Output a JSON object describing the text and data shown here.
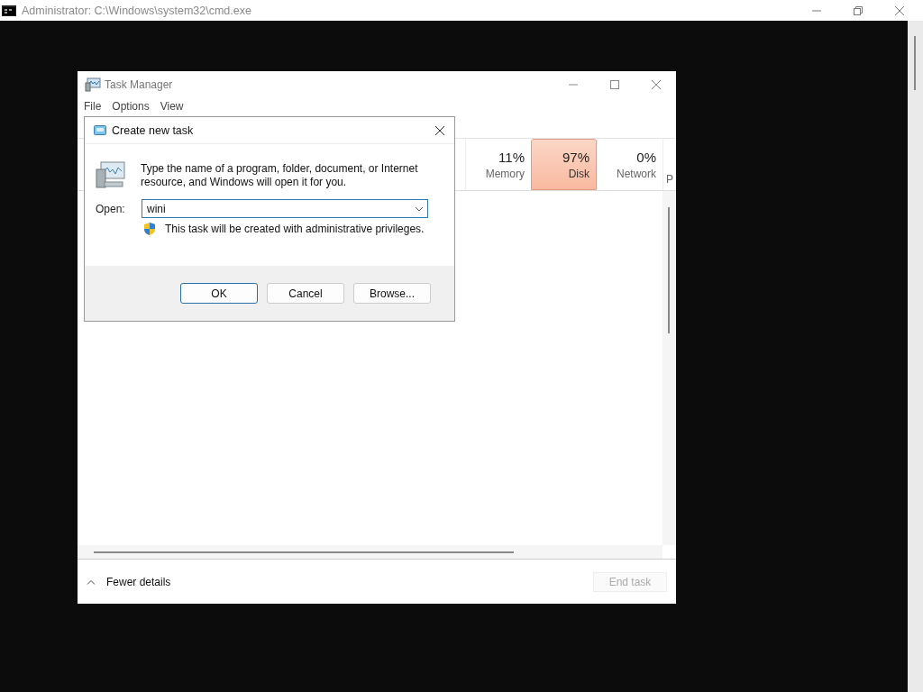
{
  "console": {
    "title": "Administrator: C:\\Windows\\system32\\cmd.exe"
  },
  "task_manager": {
    "title": "Task Manager",
    "menu": [
      "File",
      "Options",
      "View"
    ],
    "columns": [
      {
        "percent": "11%",
        "label": "Memory",
        "selected": false
      },
      {
        "percent": "97%",
        "label": "Disk",
        "selected": true
      },
      {
        "percent": "0%",
        "label": "Network",
        "selected": false
      },
      {
        "label": "P",
        "selected": false
      }
    ],
    "footer": {
      "details_toggle": "Fewer details",
      "end_task": {
        "label": "End task",
        "disabled": true
      }
    }
  },
  "dialog": {
    "title": "Create new task",
    "message": "Type the name of a program, folder, document, or Internet resource, and Windows will open it for you.",
    "open_label": "Open:",
    "open_value": "wini",
    "admin_note": "This task will be created with administrative privileges.",
    "buttons": [
      {
        "label": "OK",
        "default": true
      },
      {
        "label": "Cancel",
        "default": false
      },
      {
        "label": "Browse...",
        "default": false
      }
    ]
  }
}
